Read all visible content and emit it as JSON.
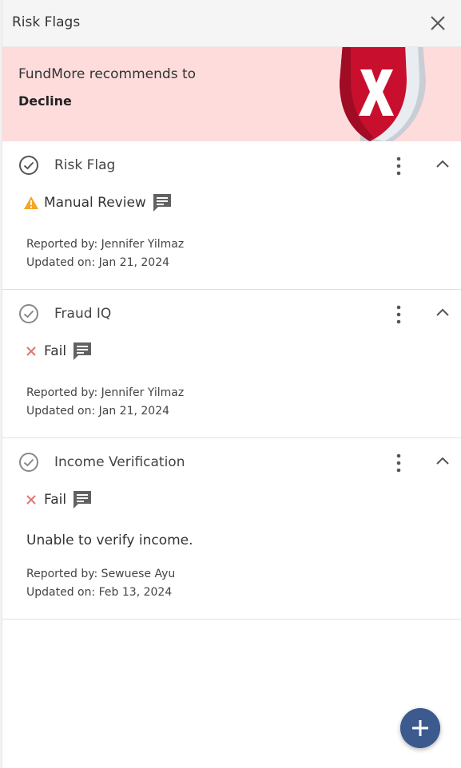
{
  "header": {
    "title": "Risk Flags"
  },
  "banner": {
    "line1": "FundMore recommends to",
    "decision": "Decline"
  },
  "flags": [
    {
      "title": "Risk Flag",
      "status": "Manual Review",
      "status_icon": "warning-icon",
      "note": "",
      "reported_by": "Reported by: Jennifer Yilmaz",
      "updated_on": "Updated on: Jan 21, 2024"
    },
    {
      "title": "Fraud IQ",
      "status": "Fail",
      "status_icon": "fail-x-icon",
      "note": "",
      "reported_by": "Reported by: Jennifer Yilmaz",
      "updated_on": "Updated on: Jan 21, 2024"
    },
    {
      "title": "Income Verification",
      "status": "Fail",
      "status_icon": "fail-x-icon",
      "note": "Unable to verify income.",
      "reported_by": "Reported by: Sewuese Ayu",
      "updated_on": "Updated on: Feb 13, 2024"
    }
  ],
  "colors": {
    "banner_bg": "#ffdcdc",
    "shield_red": "#c8102e",
    "warning": "#f5a623",
    "fail": "#e57373",
    "fab": "#3c5a8e"
  }
}
